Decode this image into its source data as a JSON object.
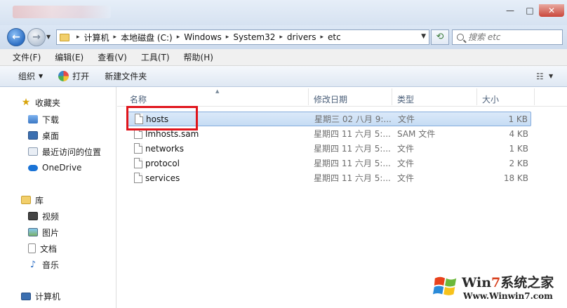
{
  "window": {
    "controls": {
      "minimize": "—",
      "maximize": "□",
      "close": "✕"
    }
  },
  "address": {
    "crumbs": [
      "计算机",
      "本地磁盘 (C:)",
      "Windows",
      "System32",
      "drivers",
      "etc"
    ],
    "separator": "▸",
    "search_placeholder": "搜索 etc"
  },
  "menu": [
    "文件(F)",
    "编辑(E)",
    "查看(V)",
    "工具(T)",
    "帮助(H)"
  ],
  "toolbar": {
    "organize": "组织",
    "open": "打开",
    "new_folder": "新建文件夹"
  },
  "sidebar": {
    "favorites": "收藏夹",
    "favorites_items": [
      "下载",
      "桌面",
      "最近访问的位置"
    ],
    "onedrive": "OneDrive",
    "libraries": "库",
    "library_items": [
      "视频",
      "图片",
      "文档",
      "音乐"
    ],
    "computer": "计算机"
  },
  "columns": {
    "name": "名称",
    "date": "修改日期",
    "type": "类型",
    "size": "大小"
  },
  "files": [
    {
      "name": "hosts",
      "date": "星期三 02 八月 9:...",
      "type": "文件",
      "size": "1 KB"
    },
    {
      "name": "lmhosts.sam",
      "date": "星期四 11 六月 5:...",
      "type": "SAM 文件",
      "size": "4 KB"
    },
    {
      "name": "networks",
      "date": "星期四 11 六月 5:...",
      "type": "文件",
      "size": "1 KB"
    },
    {
      "name": "protocol",
      "date": "星期四 11 六月 5:...",
      "type": "文件",
      "size": "2 KB"
    },
    {
      "name": "services",
      "date": "星期四 11 六月 5:...",
      "type": "文件",
      "size": "18 KB"
    }
  ],
  "watermark": {
    "brand_prefix": "Win",
    "brand_seven": "7",
    "brand_suffix": "系统之家",
    "url": "Www.Winwin7.com"
  },
  "colors": {
    "accent": "#3b78c4",
    "highlight": "#e0141b"
  }
}
